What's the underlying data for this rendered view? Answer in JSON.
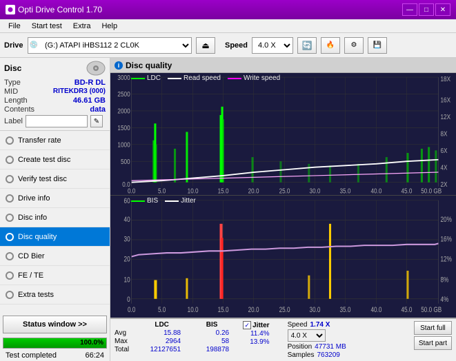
{
  "titlebar": {
    "title": "Opti Drive Control 1.70",
    "minimize_label": "—",
    "maximize_label": "□",
    "close_label": "✕"
  },
  "menubar": {
    "items": [
      "File",
      "Start test",
      "Extra",
      "Help"
    ]
  },
  "toolbar": {
    "drive_label": "Drive",
    "drive_value": "(G:) ATAPI iHBS112 2 CL0K",
    "speed_label": "Speed",
    "speed_value": "4.0 X"
  },
  "disc": {
    "title": "Disc",
    "type_label": "Type",
    "type_value": "BD-R DL",
    "mid_label": "MID",
    "mid_value": "RITEKDR3 (000)",
    "length_label": "Length",
    "length_value": "46.61 GB",
    "contents_label": "Contents",
    "contents_value": "data",
    "label_label": "Label",
    "label_value": ""
  },
  "nav": {
    "items": [
      {
        "id": "transfer-rate",
        "label": "Transfer rate",
        "active": false
      },
      {
        "id": "create-test-disc",
        "label": "Create test disc",
        "active": false
      },
      {
        "id": "verify-test-disc",
        "label": "Verify test disc",
        "active": false
      },
      {
        "id": "drive-info",
        "label": "Drive info",
        "active": false
      },
      {
        "id": "disc-info",
        "label": "Disc info",
        "active": false
      },
      {
        "id": "disc-quality",
        "label": "Disc quality",
        "active": true
      },
      {
        "id": "cd-bier",
        "label": "CD Bier",
        "active": false
      },
      {
        "id": "fe-te",
        "label": "FE / TE",
        "active": false
      },
      {
        "id": "extra-tests",
        "label": "Extra tests",
        "active": false
      }
    ]
  },
  "status": {
    "button_label": "Status window >>",
    "progress_value": 100,
    "progress_text": "100.0%",
    "status_text": "Test completed",
    "time_text": "66:24"
  },
  "chart": {
    "title": "Disc quality",
    "legend1": {
      "ldc_label": "LDC",
      "read_label": "Read speed",
      "write_label": "Write speed"
    },
    "legend2": {
      "bis_label": "BIS",
      "jitter_label": "Jitter"
    },
    "top_y_left": [
      "3000",
      "2500",
      "2000",
      "1500",
      "1000",
      "500",
      "0.0"
    ],
    "top_y_right": [
      "18X",
      "16X",
      "14X",
      "12X",
      "10X",
      "8X",
      "6X",
      "4X",
      "2X"
    ],
    "top_x": [
      "0.0",
      "5.0",
      "10.0",
      "15.0",
      "20.0",
      "25.0",
      "30.0",
      "35.0",
      "40.0",
      "45.0",
      "50.0 GB"
    ],
    "bot_y_left": [
      "60",
      "50",
      "40",
      "30",
      "20",
      "10",
      "0"
    ],
    "bot_y_right": [
      "20%",
      "16%",
      "12%",
      "8%",
      "4%"
    ],
    "bot_x": [
      "0.0",
      "5.0",
      "10.0",
      "15.0",
      "20.0",
      "25.0",
      "30.0",
      "35.0",
      "40.0",
      "45.0",
      "50.0 GB"
    ]
  },
  "stats": {
    "ldc_label": "LDC",
    "bis_label": "BIS",
    "jitter_label": "Jitter",
    "jitter_checked": true,
    "avg_label": "Avg",
    "max_label": "Max",
    "total_label": "Total",
    "ldc_avg": "15.88",
    "ldc_max": "2964",
    "ldc_total": "12127651",
    "bis_avg": "0.26",
    "bis_max": "58",
    "bis_total": "198878",
    "jitter_avg": "11.4%",
    "jitter_max": "13.9%",
    "speed_label": "Speed",
    "speed_value": "1.74 X",
    "speed_select": "4.0 X",
    "position_label": "Position",
    "position_value": "47731 MB",
    "samples_label": "Samples",
    "samples_value": "763209",
    "start_full_label": "Start full",
    "start_part_label": "Start part"
  }
}
